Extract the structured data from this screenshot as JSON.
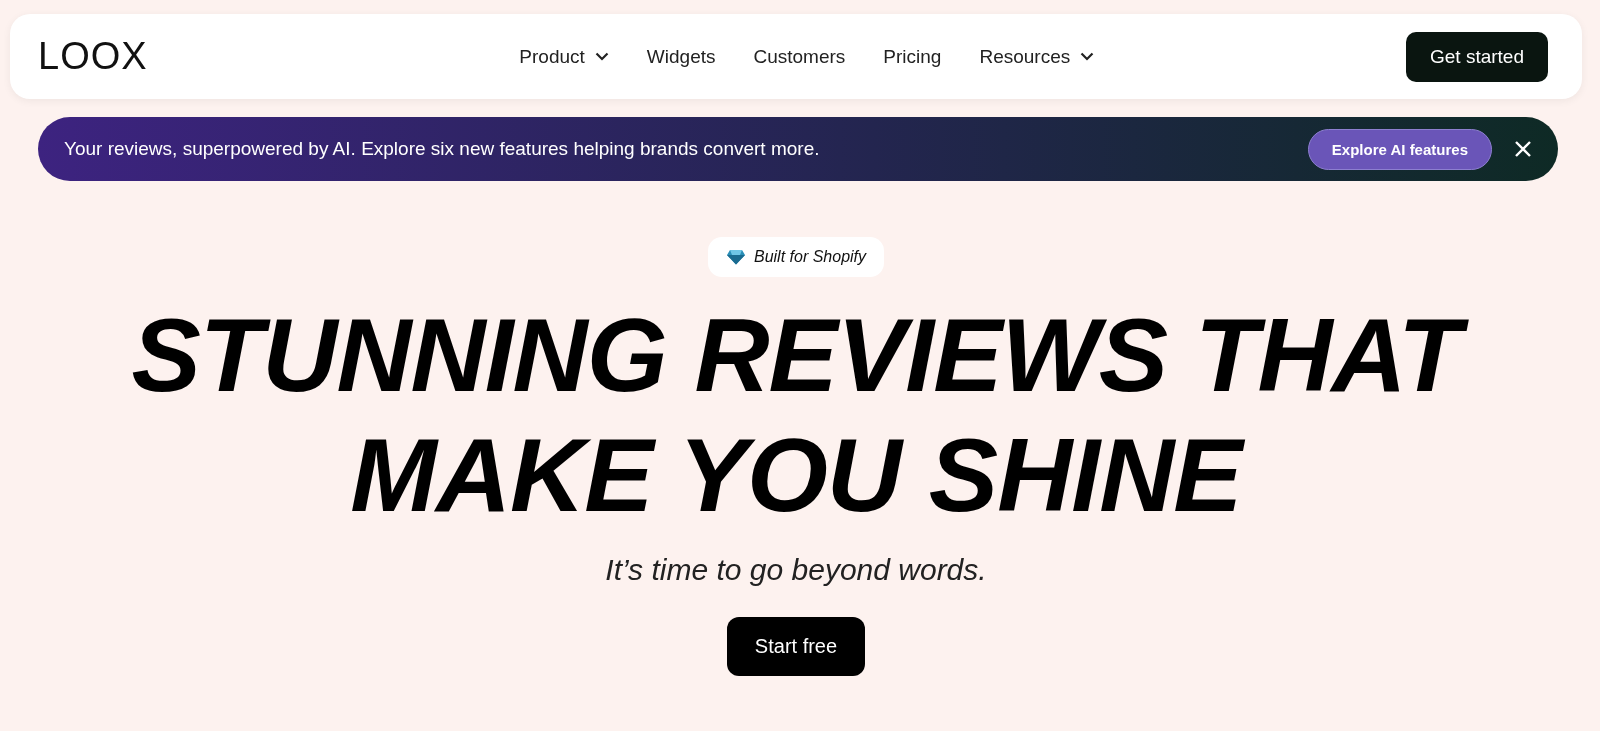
{
  "logo": "LOOX",
  "nav": [
    {
      "label": "Product",
      "has_dropdown": true
    },
    {
      "label": "Widgets",
      "has_dropdown": false
    },
    {
      "label": "Customers",
      "has_dropdown": false
    },
    {
      "label": "Pricing",
      "has_dropdown": false
    },
    {
      "label": "Resources",
      "has_dropdown": true
    }
  ],
  "cta": "Get started",
  "banner": {
    "text": "Your reviews, superpowered by AI. Explore six new features helping brands convert more.",
    "button": "Explore AI features"
  },
  "hero": {
    "badge": "Built for Shopify",
    "headline_lines": [
      "STUNNING REVIEWS THAT",
      "MAKE YOU SHINE"
    ],
    "subtitle": "It’s time to go beyond words.",
    "button": "Start free"
  }
}
